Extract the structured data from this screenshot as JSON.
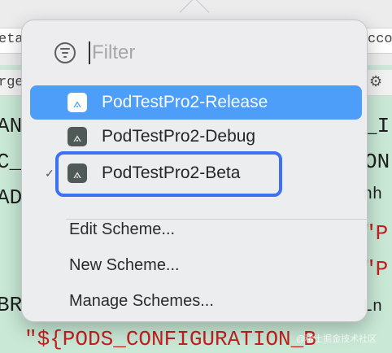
{
  "background": {
    "tab_fragments": [
      "eta",
      "cco"
    ],
    "path_fragment": "rge",
    "code_left": [
      "AN",
      "C_",
      "AD",
      "BR"
    ],
    "code_right": [
      "_I",
      "ON",
      "nh",
      "\"P",
      "\"P",
      "Ln"
    ],
    "code_bottom": "\"${PODS_CONFIGURATION_B"
  },
  "popover": {
    "filter": {
      "placeholder": "Filter",
      "value": ""
    },
    "schemes": [
      {
        "label": "PodTestPro2-Release",
        "selected": true,
        "checked": false
      },
      {
        "label": "PodTestPro2-Debug",
        "selected": false,
        "checked": false
      },
      {
        "label": "PodTestPro2-Beta",
        "selected": false,
        "checked": true
      }
    ],
    "actions": [
      "Edit Scheme...",
      "New Scheme...",
      "Manage Schemes..."
    ]
  },
  "watermark": "@稀土掘金技术社区",
  "colors": {
    "selection": "#4d9ef8",
    "highlight": "#3d70f2",
    "code_bg": "#c9e8d6"
  }
}
